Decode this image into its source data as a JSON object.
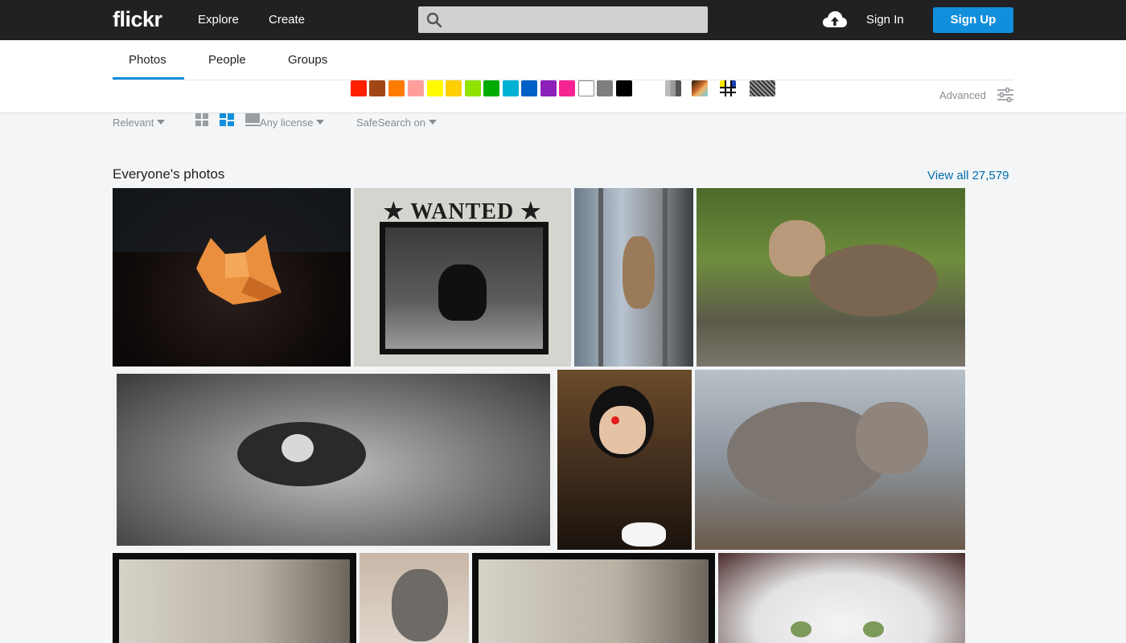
{
  "header": {
    "logo": "flickr",
    "nav": [
      "Explore",
      "Create"
    ],
    "search_placeholder": "",
    "signin": "Sign In",
    "signup": "Sign Up"
  },
  "tabs": [
    "Photos",
    "People",
    "Groups"
  ],
  "color_swatches": [
    "#ff2000",
    "#a24615",
    "#ff7c00",
    "#ff9f9c",
    "#fffa00",
    "#ffcf00",
    "#90e200",
    "#00ab00",
    "#00b2d4",
    "#0062c6",
    "#8c20ba",
    "#f52394",
    "#ffffff",
    "#7e7e7e",
    "#000000"
  ],
  "advanced": "Advanced",
  "filters": {
    "sort": "Relevant",
    "license": "Any license",
    "safesearch": "SafeSearch on"
  },
  "section": {
    "title": "Everyone's photos",
    "view_all": "View all 27,579"
  },
  "colors": {
    "accent": "#128fdc",
    "link": "#006dac",
    "topbar": "#212124"
  }
}
